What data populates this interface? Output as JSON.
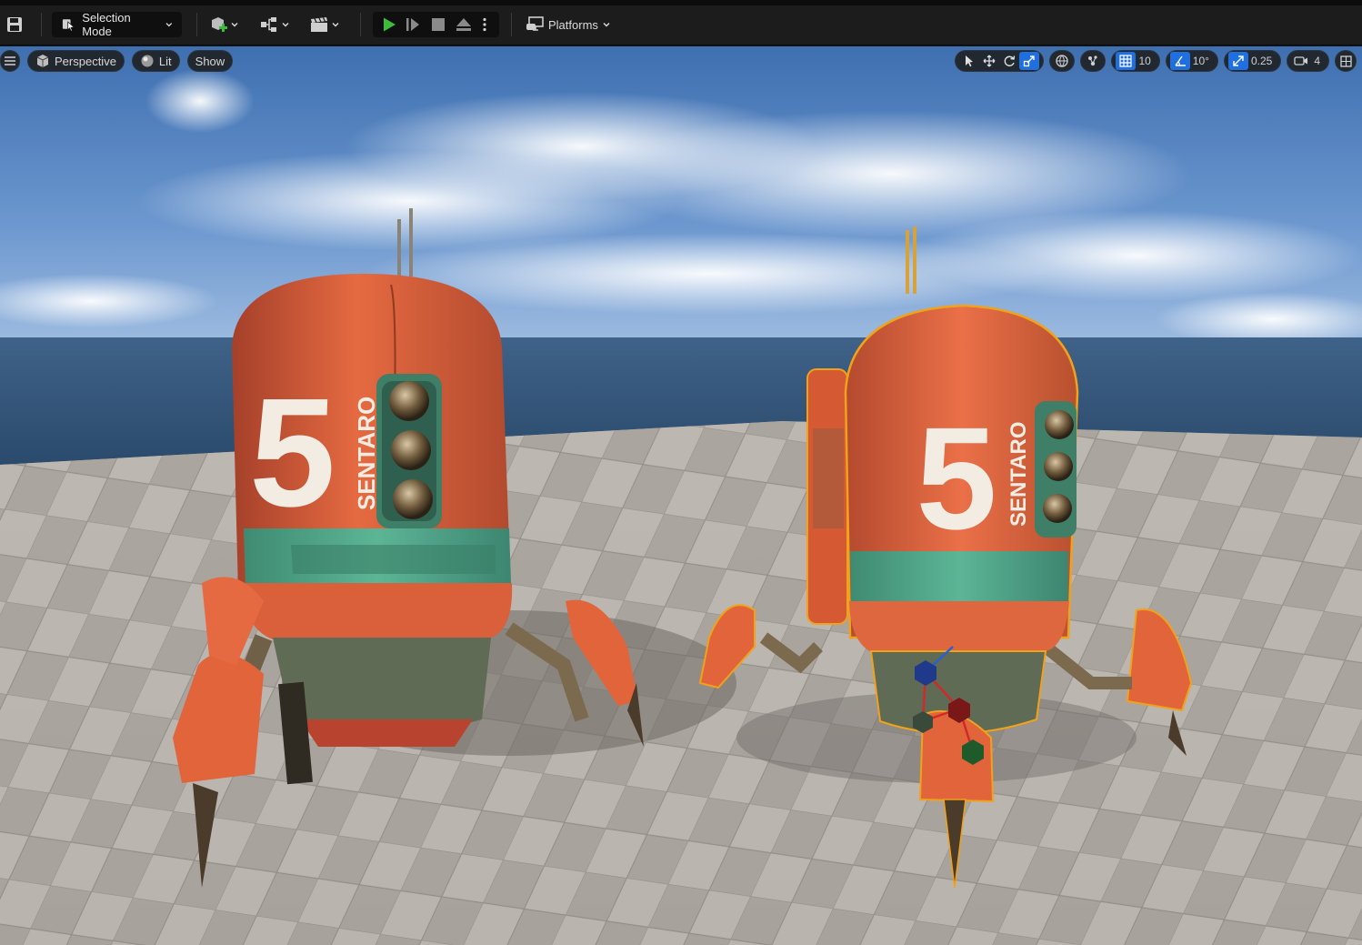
{
  "toolbar": {
    "selection_mode_label": "Selection Mode",
    "platforms_label": "Platforms"
  },
  "viewport": {
    "view_mode_label": "Perspective",
    "lighting_label": "Lit",
    "show_label": "Show",
    "grid_snap_value": "10",
    "rotation_snap_value": "10°",
    "scale_snap_value": "0.25",
    "camera_speed_value": "4"
  },
  "scene": {
    "robot_number": "5",
    "robot_brand": "SENTARO",
    "colors": {
      "robot_orange": "#e2643a",
      "robot_teal": "#4fa88b",
      "selection_outline": "#f0a21a",
      "accent_blue": "#1f6fe0",
      "play_green": "#3dbb3d"
    }
  },
  "icons": [
    "save-icon",
    "selection-mode-icon",
    "add-actor-icon",
    "blueprint-icon",
    "cinematics-icon",
    "play-icon",
    "advance-frame-icon",
    "stop-icon",
    "eject-icon",
    "kebab-icon",
    "platforms-icon",
    "hamburger-icon",
    "perspective-cube-icon",
    "lit-sphere-icon",
    "select-arrow-icon",
    "translate-icon",
    "rotate-icon",
    "scale-icon",
    "world-local-icon",
    "surface-snap-icon",
    "grid-snap-icon",
    "rotation-snap-icon",
    "scale-snap-icon",
    "camera-speed-icon",
    "maximize-icon"
  ]
}
